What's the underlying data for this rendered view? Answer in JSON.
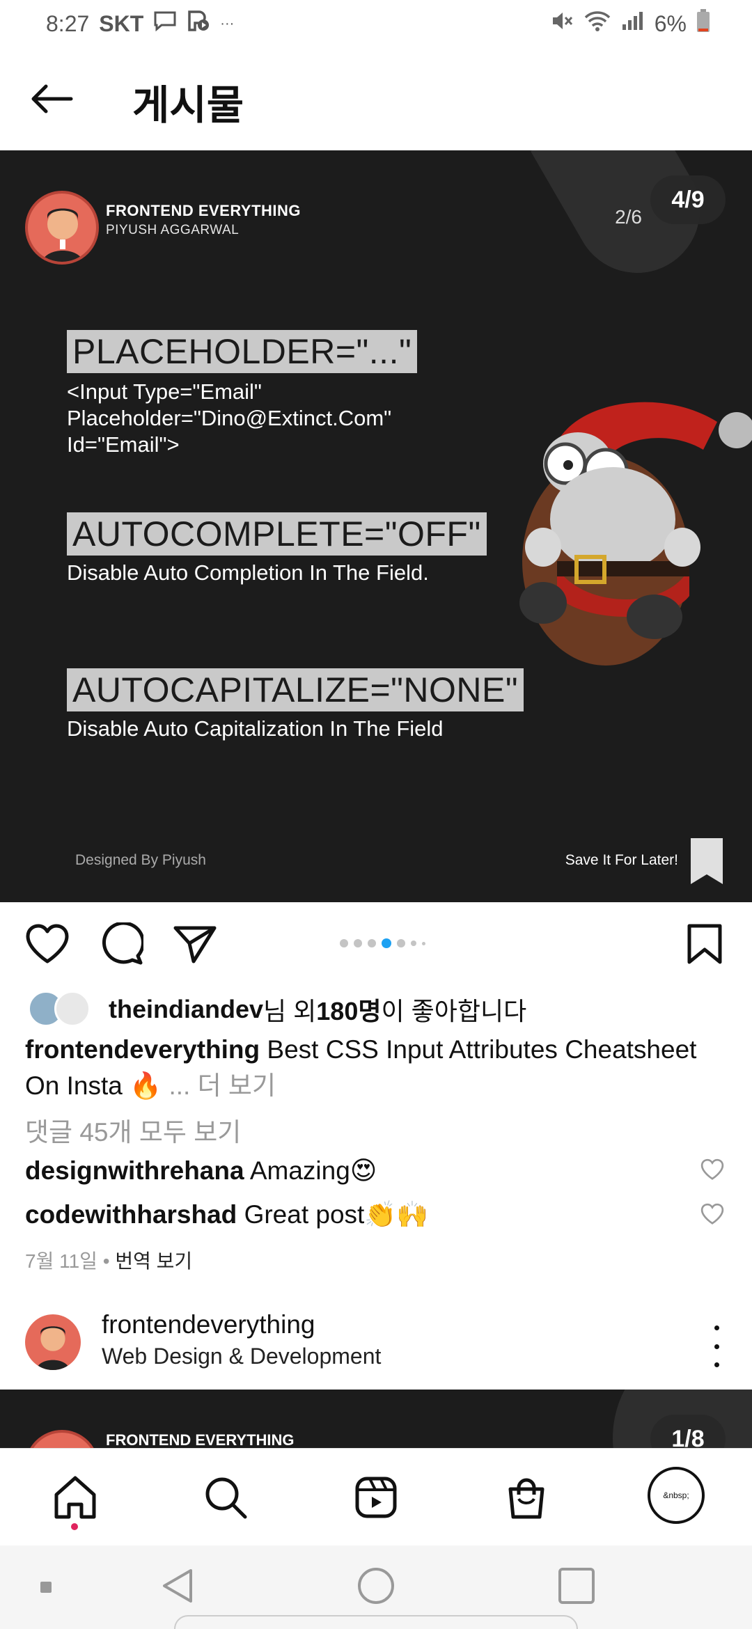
{
  "status_bar": {
    "time": "8:27",
    "carrier": "SKT",
    "more": "···",
    "battery": "6%"
  },
  "header": {
    "title": "게시물"
  },
  "post": {
    "author_name": "FRONTEND EVERYTHING",
    "author_sub": "PIYUSH AGGARWAL",
    "slide_page": "2/6",
    "counter": "4/9",
    "items": [
      {
        "tag": "PLACEHOLDER=\"...\"",
        "desc": "<Input Type=\"Email\"\nPlaceholder=\"Dino@Extinct.Com\"\nId=\"Email\">"
      },
      {
        "tag": "AUTOCOMPLETE=\"OFF\"",
        "desc": "Disable Auto Completion In The Field."
      },
      {
        "tag": "AUTOCAPITALIZE=\"NONE\"",
        "desc": "Disable Auto Capitalization In The Field"
      }
    ],
    "designed_by": "Designed By Piyush",
    "save_later": "Save It For Later!"
  },
  "likes": {
    "user": "theindiandev",
    "suffix_1": "님 외 ",
    "count": "180명",
    "suffix_2": "이 좋아합니다"
  },
  "caption": {
    "user": "frontendeverything",
    "text": "Best CSS Input Attributes Cheatsheet On Insta 🔥",
    "more": "... 더 보기"
  },
  "view_comments": "댓글 45개 모두 보기",
  "comments": [
    {
      "user": "designwithrehana",
      "text": "Amazing😍"
    },
    {
      "user": "codewithharshad",
      "text": "Great post👏🙌"
    }
  ],
  "date": {
    "text": "7월 11일",
    "separator": " • ",
    "translate": "번역 보기"
  },
  "next_post": {
    "user": "frontendeverything",
    "subtitle": "Web Design & Development",
    "counter": "1/8",
    "author_name": "FRONTEND EVERYTHING"
  },
  "bottom_nav": {
    "profile_label": "&nbsp;"
  },
  "colors": {
    "post_bg": "#1c1c1c",
    "tag_bg": "#c9c9c9",
    "active_dot": "#1da1f2",
    "notification_dot": "#e0245e"
  }
}
